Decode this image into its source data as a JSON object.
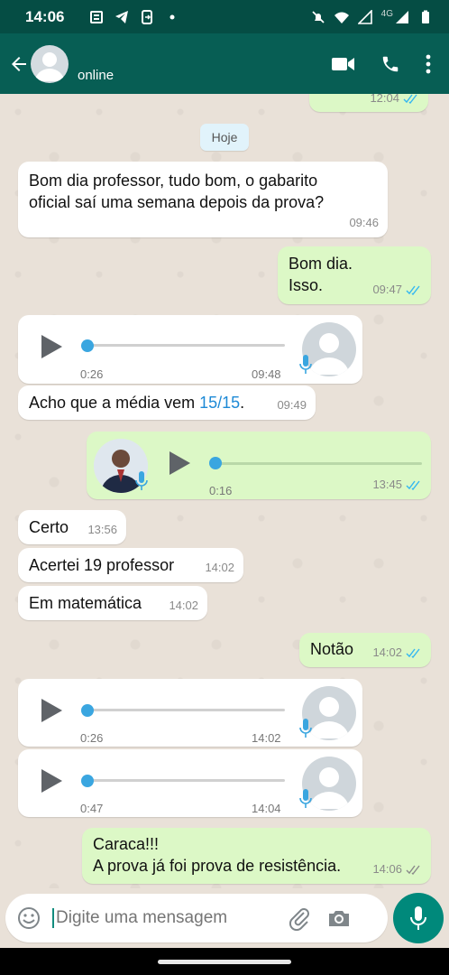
{
  "status_bar": {
    "time": "14:06",
    "network": "4G"
  },
  "header": {
    "status": "online"
  },
  "chat": {
    "top_partial_time": "12:04",
    "date_chip": "Hoje",
    "messages": [
      {
        "text_1": "Bom dia professor, tudo bom, o gabarito",
        "text_2": "oficial saí uma semana depois da prova?",
        "time": "09:46"
      },
      {
        "text_1": "Bom dia.",
        "text_2": "Isso.",
        "time": "09:47"
      },
      {
        "duration": "0:26",
        "time": "09:48",
        "progress": 0
      },
      {
        "text_prefix": "Acho que a média vem ",
        "text_link": "15/15",
        "text_suffix": ".",
        "time": "09:49"
      },
      {
        "duration": "0:16",
        "time": "13:45",
        "progress": 0
      },
      {
        "text": "Certo",
        "time": "13:56"
      },
      {
        "text": "Acertei 19 professor",
        "time": "14:02"
      },
      {
        "text": "Em matemática",
        "time": "14:02"
      },
      {
        "text": "Notão",
        "time": "14:02"
      },
      {
        "duration": "0:26",
        "time": "14:02",
        "progress": 0
      },
      {
        "duration": "0:47",
        "time": "14:04",
        "progress": 0
      },
      {
        "text_1": "Caraca!!!",
        "text_2": "A prova já foi prova de resistência.",
        "time": "14:06"
      }
    ]
  },
  "composer": {
    "placeholder": "Digite uma mensagem"
  },
  "colors": {
    "header": "#075e54",
    "outgoing": "#dcf8c6",
    "incoming": "#ffffff",
    "accent": "#00897b",
    "read_ticks": "#34b7f1"
  }
}
